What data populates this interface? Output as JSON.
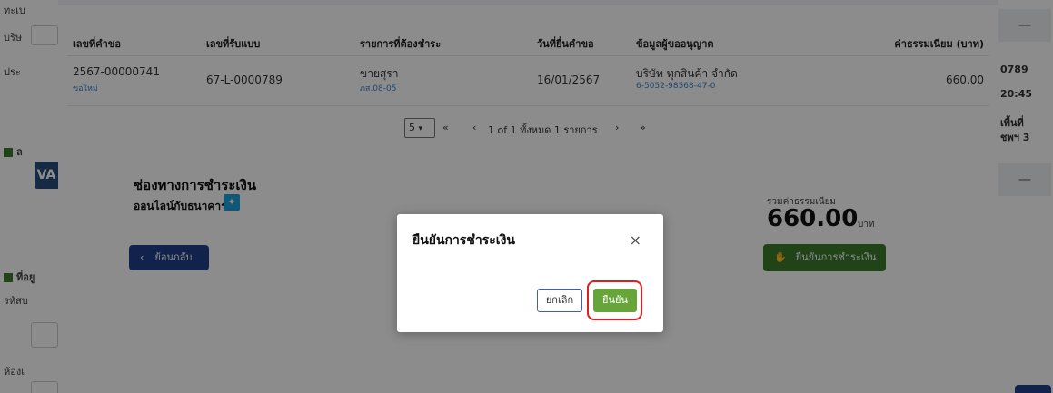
{
  "background_left": {
    "frags": [
      "ทะเบ",
      "บริษ",
      "ประ",
      "ล",
      "ที่อยู",
      "รหัสบ",
      "ห้องเ"
    ],
    "va_badge": "VA"
  },
  "background_right": {
    "dash1": "—",
    "frags": [
      "0789",
      "20:45",
      "เพื้นที่",
      "ชพฯ 3"
    ],
    "dash2": "—"
  },
  "table": {
    "columns": [
      "เลขที่คำขอ",
      "เลขที่รับแบบ",
      "รายการที่ต้องชำระ",
      "วันที่ยื่นคำขอ",
      "ข้อมูลผู้ขออนุญาต",
      "ค่าธรรมเนียม (บาท)"
    ],
    "rows": [
      {
        "request_no": "2567-00000741",
        "request_sub": "ขอใหม่",
        "receipt_no": "67-L-0000789",
        "item": "ขายสุรา",
        "item_sub": "ภส.08-05",
        "date": "16/01/2567",
        "applicant": "บริษัท ทุกสินค้า จำกัด",
        "applicant_sub": "6-5052-98568-47-0",
        "fee": "660.00"
      }
    ]
  },
  "pager": {
    "page_size": "5",
    "first": "«",
    "prev": "‹",
    "summary": "1 of 1 ทั้งหมด 1 รายการ",
    "next": "›",
    "last": "»"
  },
  "payment": {
    "title": "ช่องทางการชำระเงิน",
    "method": "ออนไลน์กับธนาคาร",
    "back_label": "ย้อนกลับ",
    "total_label": "รวมค่าธรรมเนียม",
    "total_amount": "660.00",
    "total_unit": "บาท",
    "confirm_label": "ยืนยันการชำระเงิน"
  },
  "modal": {
    "title": "ยืนยันการชำระเงิน",
    "close": "×",
    "cancel_label": "ยกเลิก",
    "confirm_label": "ยืนยัน"
  }
}
